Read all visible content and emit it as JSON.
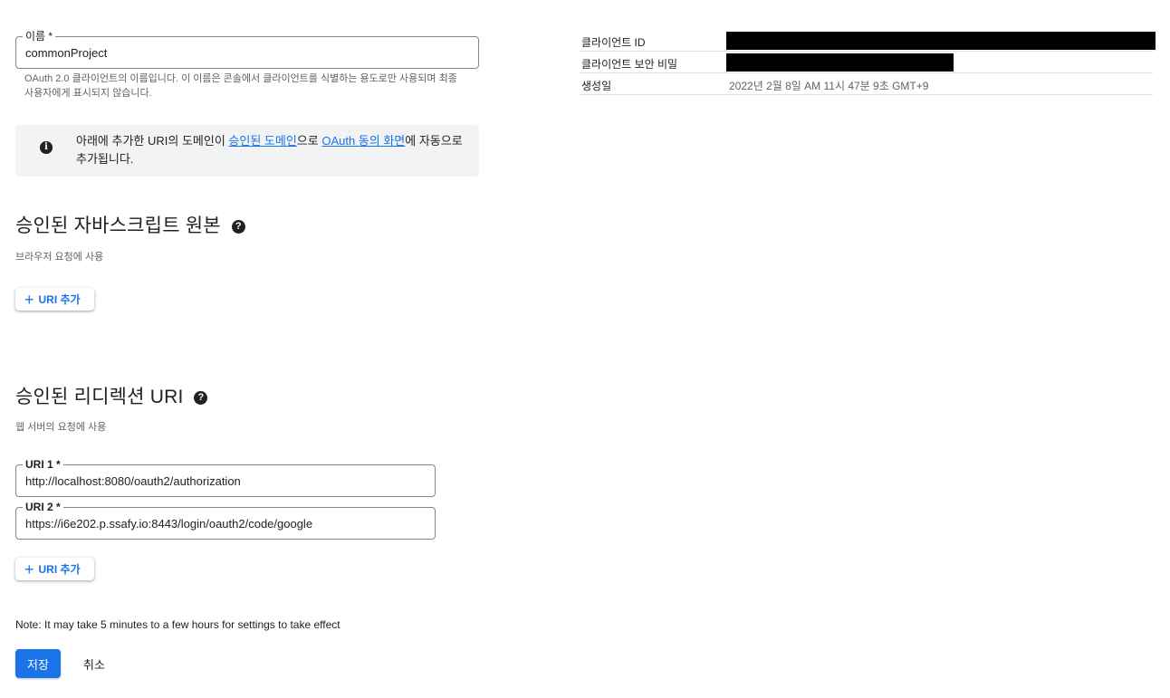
{
  "name_field": {
    "label": "이름 *",
    "value": "commonProject",
    "hint": "OAuth 2.0 클라이언트의 이름입니다. 이 이름은 콘솔에서 클라이언트를 식별하는 용도로만 사용되며 최종 사용자에게 표시되지 않습니다."
  },
  "info": {
    "text_before": "아래에 추가한 URI의 도메인이 ",
    "link1": "승인된 도메인",
    "text_middle": "으로 ",
    "link2": "OAuth 동의 화면",
    "text_after": "에 자동으로 추가됩니다."
  },
  "js_origins": {
    "title": "승인된 자바스크립트 원본",
    "subtitle": "브라우저 요청에 사용",
    "add_label": "URI 추가"
  },
  "redirect_uris": {
    "title": "승인된 리디렉션 URI",
    "subtitle": "웹 서버의 요청에 사용",
    "uris": [
      {
        "label": "URI 1 *",
        "value": "http://localhost:8080/oauth2/authorization"
      },
      {
        "label": "URI 2 *",
        "value": "https://i6e202.p.ssafy.io:8443/login/oauth2/code/google"
      }
    ],
    "add_label": "URI 추가"
  },
  "note": "Note: It may take 5 minutes to a few hours for settings to take effect",
  "actions": {
    "save": "저장",
    "cancel": "취소"
  },
  "details": {
    "client_id_label": "클라이언트 ID",
    "client_secret_label": "클라이언트 보안 비밀",
    "created_label": "생성일",
    "created_value": "2022년 2월 8일 AM 11시 47분 9초 GMT+9"
  },
  "colors": {
    "accent": "#1a73e8",
    "info_bg": "#f1f3f4",
    "redaction": "#000000"
  },
  "icons": {
    "info": "info-icon",
    "help": "help-icon",
    "add": "plus-icon"
  }
}
